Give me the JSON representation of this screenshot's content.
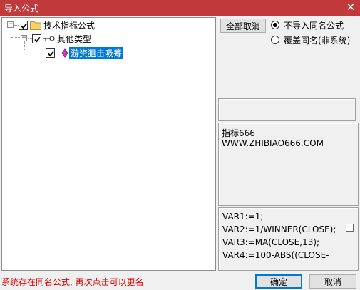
{
  "window": {
    "title": "导入公式",
    "close_glyph": "✕"
  },
  "tree": {
    "root_label": "技术指标公式",
    "child_label": "其他类型",
    "leaf_label": "游资狙击吸筹"
  },
  "options": {
    "toggle_all_label": "全部取消",
    "radio_skip_label": "不导入同名公式",
    "radio_overwrite_label": "覆盖同名(非系统)"
  },
  "description": {
    "line1": "指标666",
    "line2": "WWW.ZHIBIAO666.COM"
  },
  "code": {
    "lines": [
      "VAR1:=1;",
      "VAR2:=1/WINNER(CLOSE);",
      "VAR3:=MA(CLOSE,13);",
      "VAR4:=100-ABS((CLOSE-"
    ]
  },
  "status": {
    "message": "系统存在同名公式, 再次点击可以更名"
  },
  "buttons": {
    "ok_label": "确定",
    "cancel_label": "取消"
  },
  "colors": {
    "titlebar": "#c0393b",
    "selection": "#0078d7",
    "status_text": "#e00000",
    "folder": "#f5d36a"
  }
}
